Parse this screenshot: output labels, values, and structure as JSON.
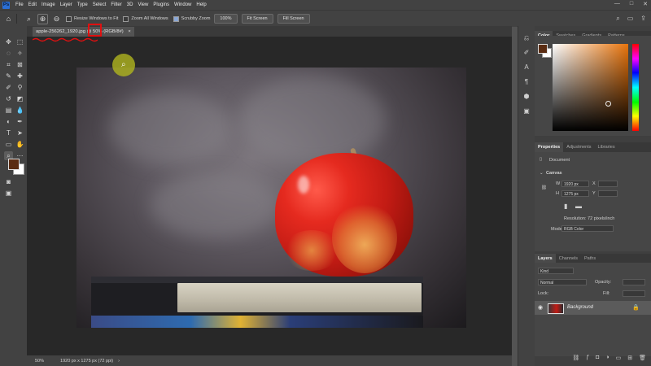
{
  "app": {
    "logo": "Ps",
    "menus": [
      "File",
      "Edit",
      "Image",
      "Layer",
      "Type",
      "Select",
      "Filter",
      "3D",
      "View",
      "Plugins",
      "Window",
      "Help"
    ],
    "window_controls": [
      "—",
      "□",
      "✕"
    ]
  },
  "options_bar": {
    "resize_windows": "Resize Windows to Fit",
    "zoom_all": "Zoom All Windows",
    "scrubby_zoom": "Scrubby Zoom",
    "zoom_100": "100%",
    "fit_screen": "Fit Screen",
    "fill_screen": "Fill Screen",
    "icons": [
      "home-icon",
      "zoom-tool-icon",
      "zoom-in-icon",
      "zoom-out-icon"
    ]
  },
  "document_tab": {
    "title": "apple-256262_1920.jpg @ 50% (RGB/8#)",
    "close": "×"
  },
  "status_bar": {
    "zoom": "50%",
    "doc_info": "1920 px x 1275 px (72 ppi)",
    "arrow": "›"
  },
  "color_panel": {
    "tabs": [
      "Color",
      "Swatches",
      "Gradients",
      "Patterns"
    ],
    "foreground": "#5a2c12",
    "background": "#ffffff"
  },
  "properties_panel": {
    "tabs": [
      "Properties",
      "Adjustments",
      "Libraries"
    ],
    "document_label": "Document",
    "canvas_label": "Canvas",
    "w_label": "W",
    "w_value": "1920 px",
    "x_label": "X",
    "h_label": "H",
    "h_value": "1275 px",
    "y_label": "Y",
    "resolution": "Resolution: 72 pixels/inch",
    "mode_label": "Mode",
    "mode_value": "RGB Color"
  },
  "layers_panel": {
    "tabs": [
      "Layers",
      "Channels",
      "Paths"
    ],
    "kind_placeholder": "Kind",
    "blend_mode": "Normal",
    "opacity_label": "Opacity:",
    "lock_label": "Lock:",
    "fill_label": "Fill:",
    "layer_name": "Background"
  }
}
